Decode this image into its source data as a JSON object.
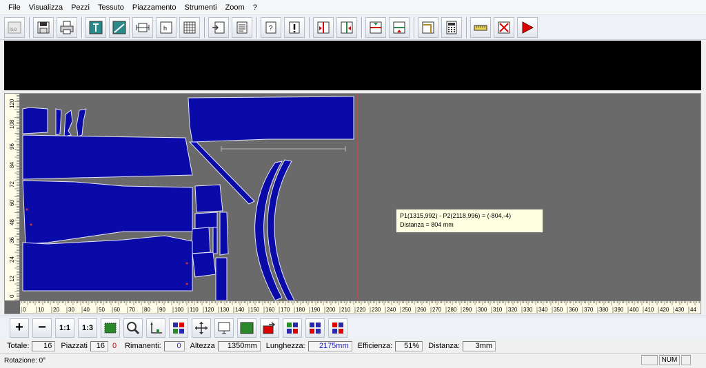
{
  "menu": [
    "File",
    "Visualizza",
    "Pezzi",
    "Tessuto",
    "Piazzamento",
    "Strumenti",
    "Zoom",
    "?"
  ],
  "toolbar": {
    "icons": [
      "iso-icon",
      "save-icon",
      "print-icon",
      "cut-icon",
      "diagonal-icon",
      "width-icon",
      "height-icon",
      "grid-icon",
      "insert-icon",
      "document-icon",
      "help-icon",
      "alert-icon",
      "flip-left-icon",
      "flip-right-icon",
      "move-down-icon",
      "move-up-icon",
      "corner-icon",
      "calculator-icon",
      "ruler-icon",
      "close-icon",
      "play-icon"
    ]
  },
  "rulers": {
    "vertical_labels": [
      "120",
      "108",
      "96",
      "84",
      "72",
      "60",
      "48",
      "36",
      "24",
      "12",
      "0"
    ],
    "horizontal_labels": [
      "0",
      "10",
      "20",
      "30",
      "40",
      "50",
      "60",
      "70",
      "80",
      "90",
      "100",
      "110",
      "120",
      "130",
      "140",
      "150",
      "160",
      "170",
      "180",
      "190",
      "200",
      "210",
      "220",
      "230",
      "240",
      "250",
      "260",
      "270",
      "280",
      "290",
      "300",
      "310",
      "320",
      "330",
      "340",
      "350",
      "360",
      "370",
      "380",
      "390",
      "400",
      "410",
      "420",
      "430",
      "44"
    ]
  },
  "tooltip": {
    "line1": "P1(1315,992) - P2(2118,996) = (-804,-4)",
    "line2": "Distanza = 804 mm"
  },
  "bottom_toolbar": {
    "btn_zoom_in": "+",
    "btn_zoom_out": "−",
    "btn_11": "1:1",
    "btn_13": "1:3"
  },
  "status": {
    "totale_label": "Totale:",
    "totale_value": "16",
    "piazzati_label": "Piazzati",
    "piazzati_value": "16",
    "piazzati_zero": "0",
    "rimanenti_label": "Rimanenti:",
    "rimanenti_value": "0",
    "altezza_label": "Altezza",
    "altezza_value": "1350mm",
    "lunghezza_label": "Lunghezza:",
    "lunghezza_value": "2175mm",
    "efficienza_label": "Efficienza:",
    "efficienza_value": "51%",
    "distanza_label": "Distanza:",
    "distanza_value": "3mm"
  },
  "bottom": {
    "rotazione": "Rotazione:  0°",
    "num": "NUM"
  },
  "colors": {
    "piece": "#0a0aa8",
    "canvas": "#6a6a6a",
    "marker_line": "#e04040",
    "lunghezza_value": "#2020c0",
    "piazzati_zero": "#cc0000"
  }
}
